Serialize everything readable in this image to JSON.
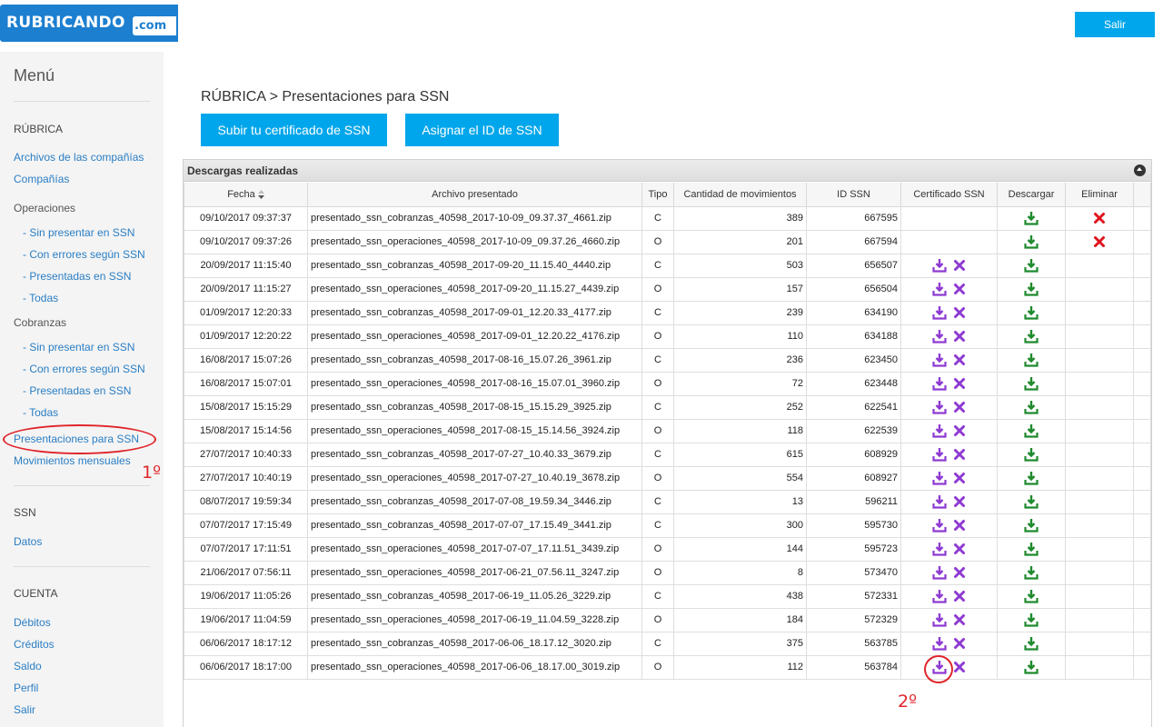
{
  "header": {
    "logo_main": "RUBRICANDO",
    "logo_suffix": ".com",
    "logout_label": "Salir"
  },
  "sidebar": {
    "menu_title": "Menú",
    "section_rubrica": "RÚBRICA",
    "link_archivos": "Archivos de las compañías",
    "link_companias": "Compañías",
    "group_operaciones": "Operaciones",
    "ops_sin_presentar": "- Sin presentar en SSN",
    "ops_con_errores": "- Con errores según SSN",
    "ops_presentadas": "- Presentadas en SSN",
    "ops_todas": "- Todas",
    "group_cobranzas": "Cobranzas",
    "cob_sin_presentar": "- Sin presentar en SSN",
    "cob_con_errores": "- Con errores según SSN",
    "cob_presentadas": "- Presentadas en SSN",
    "cob_todas": "- Todas",
    "link_presentaciones": "Presentaciones para SSN",
    "link_movimientos": "Movimientos mensuales",
    "section_ssn": "SSN",
    "link_datos": "Datos",
    "section_cuenta": "CUENTA",
    "link_debitos": "Débitos",
    "link_creditos": "Créditos",
    "link_saldo": "Saldo",
    "link_perfil": "Perfil",
    "link_salir": "Salir"
  },
  "annotations": {
    "step1": "1º",
    "step2": "2º",
    "color": "#e0262b"
  },
  "main": {
    "breadcrumb": "RÚBRICA > Presentaciones para SSN",
    "btn_subir": "Subir tu certificado de SSN",
    "btn_asignar": "Asignar el ID de SSN",
    "panel_title": "Descargas realizadas",
    "columns": [
      "Fecha",
      "Archivo presentado",
      "Tipo",
      "Cantidad de movimientos",
      "ID SSN",
      "Certificado SSN",
      "Descargar",
      "Eliminar"
    ],
    "icon_names": {
      "cert_download": "download-icon",
      "cert_remove": "close-icon",
      "download": "download-icon",
      "delete": "close-icon"
    },
    "colors": {
      "accent": "#00a6eb",
      "cert_icon": "#8e3ad2",
      "download_icon": "#1f8a2e",
      "delete_icon": "#e0141e"
    },
    "rows": [
      {
        "fecha": "09/10/2017 09:37:37",
        "archivo": "presentado_ssn_cobranzas_40598_2017-10-09_09.37.37_4661.zip",
        "tipo": "C",
        "cantidad": "389",
        "id_ssn": "667595",
        "cert": false,
        "eliminar": true
      },
      {
        "fecha": "09/10/2017 09:37:26",
        "archivo": "presentado_ssn_operaciones_40598_2017-10-09_09.37.26_4660.zip",
        "tipo": "O",
        "cantidad": "201",
        "id_ssn": "667594",
        "cert": false,
        "eliminar": true
      },
      {
        "fecha": "20/09/2017 11:15:40",
        "archivo": "presentado_ssn_cobranzas_40598_2017-09-20_11.15.40_4440.zip",
        "tipo": "C",
        "cantidad": "503",
        "id_ssn": "656507",
        "cert": true,
        "eliminar": false
      },
      {
        "fecha": "20/09/2017 11:15:27",
        "archivo": "presentado_ssn_operaciones_40598_2017-09-20_11.15.27_4439.zip",
        "tipo": "O",
        "cantidad": "157",
        "id_ssn": "656504",
        "cert": true,
        "eliminar": false
      },
      {
        "fecha": "01/09/2017 12:20:33",
        "archivo": "presentado_ssn_cobranzas_40598_2017-09-01_12.20.33_4177.zip",
        "tipo": "C",
        "cantidad": "239",
        "id_ssn": "634190",
        "cert": true,
        "eliminar": false
      },
      {
        "fecha": "01/09/2017 12:20:22",
        "archivo": "presentado_ssn_operaciones_40598_2017-09-01_12.20.22_4176.zip",
        "tipo": "O",
        "cantidad": "110",
        "id_ssn": "634188",
        "cert": true,
        "eliminar": false
      },
      {
        "fecha": "16/08/2017 15:07:26",
        "archivo": "presentado_ssn_cobranzas_40598_2017-08-16_15.07.26_3961.zip",
        "tipo": "C",
        "cantidad": "236",
        "id_ssn": "623450",
        "cert": true,
        "eliminar": false
      },
      {
        "fecha": "16/08/2017 15:07:01",
        "archivo": "presentado_ssn_operaciones_40598_2017-08-16_15.07.01_3960.zip",
        "tipo": "O",
        "cantidad": "72",
        "id_ssn": "623448",
        "cert": true,
        "eliminar": false
      },
      {
        "fecha": "15/08/2017 15:15:29",
        "archivo": "presentado_ssn_cobranzas_40598_2017-08-15_15.15.29_3925.zip",
        "tipo": "C",
        "cantidad": "252",
        "id_ssn": "622541",
        "cert": true,
        "eliminar": false
      },
      {
        "fecha": "15/08/2017 15:14:56",
        "archivo": "presentado_ssn_operaciones_40598_2017-08-15_15.14.56_3924.zip",
        "tipo": "O",
        "cantidad": "118",
        "id_ssn": "622539",
        "cert": true,
        "eliminar": false
      },
      {
        "fecha": "27/07/2017 10:40:33",
        "archivo": "presentado_ssn_cobranzas_40598_2017-07-27_10.40.33_3679.zip",
        "tipo": "C",
        "cantidad": "615",
        "id_ssn": "608929",
        "cert": true,
        "eliminar": false
      },
      {
        "fecha": "27/07/2017 10:40:19",
        "archivo": "presentado_ssn_operaciones_40598_2017-07-27_10.40.19_3678.zip",
        "tipo": "O",
        "cantidad": "554",
        "id_ssn": "608927",
        "cert": true,
        "eliminar": false
      },
      {
        "fecha": "08/07/2017 19:59:34",
        "archivo": "presentado_ssn_cobranzas_40598_2017-07-08_19.59.34_3446.zip",
        "tipo": "C",
        "cantidad": "13",
        "id_ssn": "596211",
        "cert": true,
        "eliminar": false
      },
      {
        "fecha": "07/07/2017 17:15:49",
        "archivo": "presentado_ssn_cobranzas_40598_2017-07-07_17.15.49_3441.zip",
        "tipo": "C",
        "cantidad": "300",
        "id_ssn": "595730",
        "cert": true,
        "eliminar": false
      },
      {
        "fecha": "07/07/2017 17:11:51",
        "archivo": "presentado_ssn_operaciones_40598_2017-07-07_17.11.51_3439.zip",
        "tipo": "O",
        "cantidad": "144",
        "id_ssn": "595723",
        "cert": true,
        "eliminar": false
      },
      {
        "fecha": "21/06/2017 07:56:11",
        "archivo": "presentado_ssn_operaciones_40598_2017-06-21_07.56.11_3247.zip",
        "tipo": "O",
        "cantidad": "8",
        "id_ssn": "573470",
        "cert": true,
        "eliminar": false
      },
      {
        "fecha": "19/06/2017 11:05:26",
        "archivo": "presentado_ssn_cobranzas_40598_2017-06-19_11.05.26_3229.zip",
        "tipo": "C",
        "cantidad": "438",
        "id_ssn": "572331",
        "cert": true,
        "eliminar": false
      },
      {
        "fecha": "19/06/2017 11:04:59",
        "archivo": "presentado_ssn_operaciones_40598_2017-06-19_11.04.59_3228.zip",
        "tipo": "O",
        "cantidad": "184",
        "id_ssn": "572329",
        "cert": true,
        "eliminar": false
      },
      {
        "fecha": "06/06/2017 18:17:12",
        "archivo": "presentado_ssn_cobranzas_40598_2017-06-06_18.17.12_3020.zip",
        "tipo": "C",
        "cantidad": "375",
        "id_ssn": "563785",
        "cert": true,
        "eliminar": false
      },
      {
        "fecha": "06/06/2017 18:17:00",
        "archivo": "presentado_ssn_operaciones_40598_2017-06-06_18.17.00_3019.zip",
        "tipo": "O",
        "cantidad": "112",
        "id_ssn": "563784",
        "cert": true,
        "eliminar": false
      }
    ]
  }
}
